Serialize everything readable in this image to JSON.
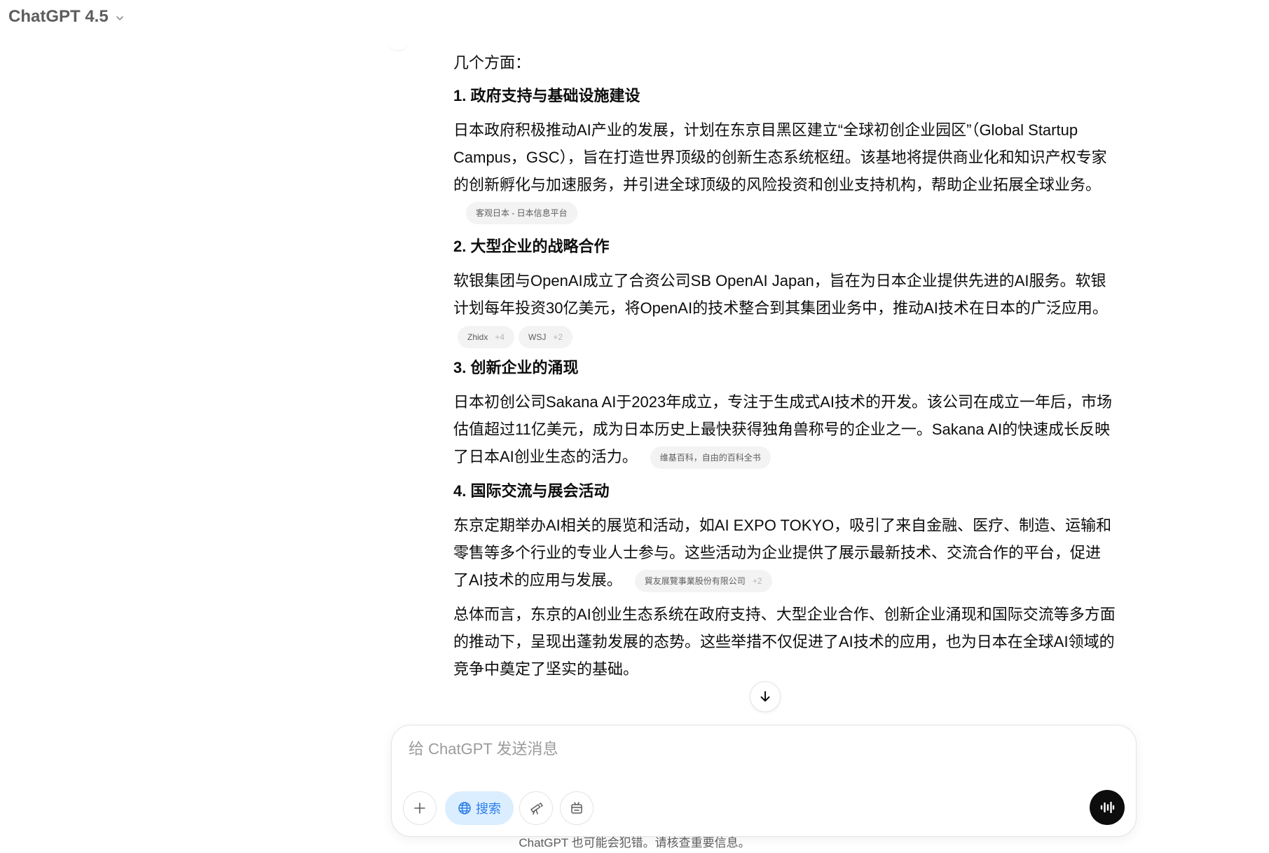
{
  "header": {
    "model_label": "ChatGPT 4.5"
  },
  "message": {
    "lead": "几个方面：",
    "sections": [
      {
        "heading": "1. 政府支持与基础设施建设",
        "text": "日本政府积极推动AI产业的发展，计划在东京目黑区建立“全球初创企业园区”（Global Startup Campus，GSC），旨在打造世界顶级的创新生态系统枢纽。该基地将提供商业化和知识产权专家的创新孵化与加速服务，并引进全球顶级的风险投资和创业支持机构，帮助企业拓展全球业务。",
        "citation": {
          "source": "客观日本 - 日本信息平台",
          "extra": ""
        }
      },
      {
        "heading": "2. 大型企业的战略合作",
        "text": "软银集团与OpenAI成立了合资公司SB OpenAI Japan，旨在为日本企业提供先进的AI服务。软银计划每年投资30亿美元，将OpenAI的技术整合到其集团业务中，推动AI技术在日本的广泛应用。",
        "citations": [
          {
            "source": "Zhidx",
            "extra": "+4"
          },
          {
            "source": "WSJ",
            "extra": "+2"
          }
        ]
      },
      {
        "heading": "3. 创新企业的涌现",
        "text": "日本初创公司Sakana AI于2023年成立，专注于生成式AI技术的开发。该公司在成立一年后，市场估值超过11亿美元，成为日本历史上最快获得独角兽称号的企业之一。Sakana AI的快速成长反映了日本AI创业生态的活力。",
        "citation": {
          "source": "维基百科，自由的百科全书",
          "extra": ""
        }
      },
      {
        "heading": "4. 国际交流与展会活动",
        "text": "东京定期举办AI相关的展览和活动，如AI EXPO TOKYO，吸引了来自金融、医疗、制造、运输和零售等多个行业的专业人士参与。这些活动为企业提供了展示最新技术、交流合作的平台，促进了AI技术的应用与发展。",
        "citation": {
          "source": "貿友展覽事業股份有限公司",
          "extra": "+2"
        }
      }
    ],
    "conclusion": "总体而言，东京的AI创业生态系统在政府支持、大型企业合作、创新企业涌现和国际交流等多方面的推动下，呈现出蓬勃发展的态势。这些举措不仅促进了AI技术的应用，也为日本在全球AI领域的竞争中奠定了坚实的基础。"
  },
  "composer": {
    "placeholder": "给 ChatGPT 发送消息",
    "value": "",
    "search_label": "搜索"
  },
  "icons": {
    "model_chevron": "chevron-down-icon",
    "scroll": "arrow-down-icon",
    "add": "plus-icon",
    "search": "globe-icon",
    "deep_research": "telescope-icon",
    "canvas": "canvas-icon",
    "voice": "voice-waveform-icon"
  },
  "footer": {
    "disclaimer": "ChatGPT 也可能会犯错。请核查重要信息。"
  }
}
